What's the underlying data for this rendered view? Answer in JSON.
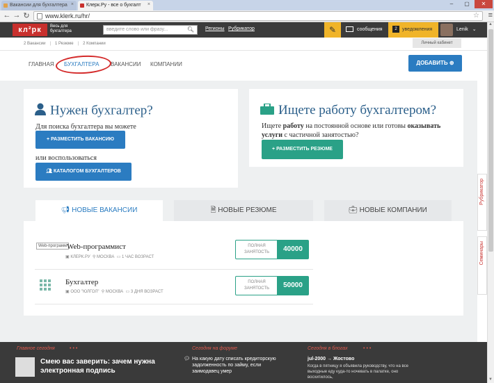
{
  "browser": {
    "tabs": [
      {
        "label": "Вакансии для бухгалтера",
        "active": false,
        "favicon_color": "#e0a24a"
      },
      {
        "label": "Клерк.Ру - все о бухгалт",
        "active": true,
        "favicon_color": "#c8302d"
      }
    ],
    "url": "www.klerk.ru/hr/",
    "window_controls": {
      "min": "–",
      "max": "▢",
      "close": "✕"
    }
  },
  "topbar": {
    "logo": "кл²рк",
    "tagline": "Весь для бухгалтера",
    "search_placeholder": "введите слово или фразу...",
    "links": [
      "Регионы",
      "Рубрикатор"
    ],
    "messages_label": "сообщения",
    "notifications_label": "уведомления",
    "notifications_count": "2",
    "username": "Lenik",
    "colors": {
      "bar": "#3b3b3b",
      "logo": "#c8302d",
      "accent": "#f0b429"
    }
  },
  "subbar": {
    "counts": [
      "2 Вакансии",
      "1 Резюме",
      "2 Компании"
    ],
    "cabinet": "Личный кабинет"
  },
  "nav": {
    "items": [
      {
        "label": "ГЛАВНАЯ",
        "active": false
      },
      {
        "label": "БУХГАЛТЕРА",
        "active": true
      },
      {
        "label": "ВАКАНСИИ",
        "active": false
      },
      {
        "label": "КОМПАНИИ",
        "active": false
      }
    ],
    "add_button": "ДОБАВИТЬ ⊕"
  },
  "card_employer": {
    "title": "Нужен бухгалтер?",
    "text1": "Для поиска бухгалтера вы можете",
    "button1": "+ РАЗМЕСТИТЬ ВАКАНСИЮ",
    "text2": "или воспользоваться",
    "button2": "КАТАЛОГОМ БУХГАЛТЕРОВ"
  },
  "card_seeker": {
    "title": "Ищете работу бухгалтером?",
    "text_a": "Ищете ",
    "text_b": "работу",
    "text_c": " на постоянной основе или готовы ",
    "text_d": "оказывать услуги",
    "text_e": " с частичной занятостью?",
    "button": "+ РАЗМЕСТИТЬ РЕЗЮМЕ"
  },
  "listing_tabs": [
    {
      "label": "НОВЫЕ ВАКАНСИИ",
      "icon": "megaphone-icon",
      "active": true
    },
    {
      "label": "НОВЫЕ РЕЗЮМЕ",
      "icon": "document-icon",
      "active": false
    },
    {
      "label": "НОВЫЕ КОМПАНИИ",
      "icon": "briefcase-icon",
      "active": false
    }
  ],
  "jobs": [
    {
      "title": "Web-программист",
      "thumb_alt": "Web-программ",
      "company": "КЛЕРК.РУ",
      "city": "МОСКВА",
      "age": "1 ЧАС ВОЗРАСТ",
      "employment": "ПОЛНАЯ ЗАНЯТОСТЬ",
      "salary": "40000"
    },
    {
      "title": "Бухгалтер",
      "company": "ООО \"ЮЛГОЛ\"",
      "city": "МОСКВА",
      "age": "3 ДНЯ ВОЗРАСТ",
      "employment": "ПОЛНАЯ ЗАНЯТОСТЬ",
      "salary": "50000"
    }
  ],
  "side_tabs": [
    "Рубрикатор",
    "Семинары"
  ],
  "footer": {
    "col1_head": "Главное сегодня",
    "col1_title": "Смею вас заверить: зачем нужна электронная подпись",
    "col2_head": "Сегодня на форуме",
    "col2_text": "На какую дату списать кредиторскую задолженность по займу, если заимодавец умер",
    "col3_head": "Сегодня в блогах",
    "col3_author": "jul-2000 → Жостово",
    "col3_text": "Когда в пятницу я объявила руководству, что на все выходные еду куда-то ночевать в палатке, оно восхитилось,"
  }
}
